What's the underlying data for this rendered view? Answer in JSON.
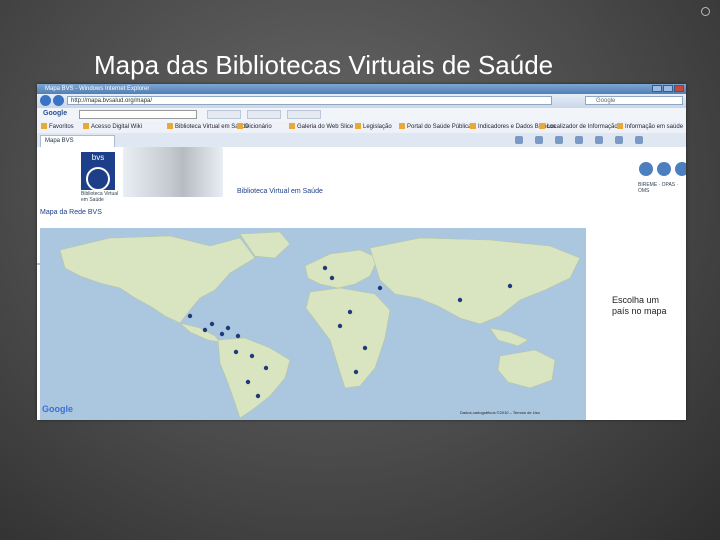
{
  "slide": {
    "title": "Mapa das Bibliotecas Virtuais de Saúde"
  },
  "browser": {
    "window_title": "Mapa BVS - Windows Internet Explorer",
    "url": "http://mapa.bvsalud.org/mapa/",
    "search_engine": "Google",
    "toolbar_brand": "Google",
    "tab_label": "Mapa BVS",
    "favorites_label": "Favoritos",
    "favorites": [
      "Acesso Digital Wiki",
      "Biblioteca Virtual em Saúde",
      "Dicionário",
      "Galeria do Web Slice",
      "Legislação",
      "Portal do Saúde Pública",
      "Indicadores e Dados Básicos",
      "Localizador de Informação",
      "Informação em saúde"
    ]
  },
  "site": {
    "logo_text": "bvs",
    "logo_subtitle": "Biblioteca Virtual em Saúde",
    "banner_title": "Biblioteca Virtual em Saúde",
    "org_logos": "BIREME · OPAS · OMS",
    "page_title": "Mapa da Rede BVS"
  },
  "map": {
    "side_panel_text": "Escolha um país no mapa",
    "provider_logo": "Google",
    "copyright": "Dados cartográficos ©2010 – Termos de Uso",
    "ocean_color": "#abc6df",
    "land_color": "#d9e4c0",
    "marker_color": "#1e3a78"
  }
}
